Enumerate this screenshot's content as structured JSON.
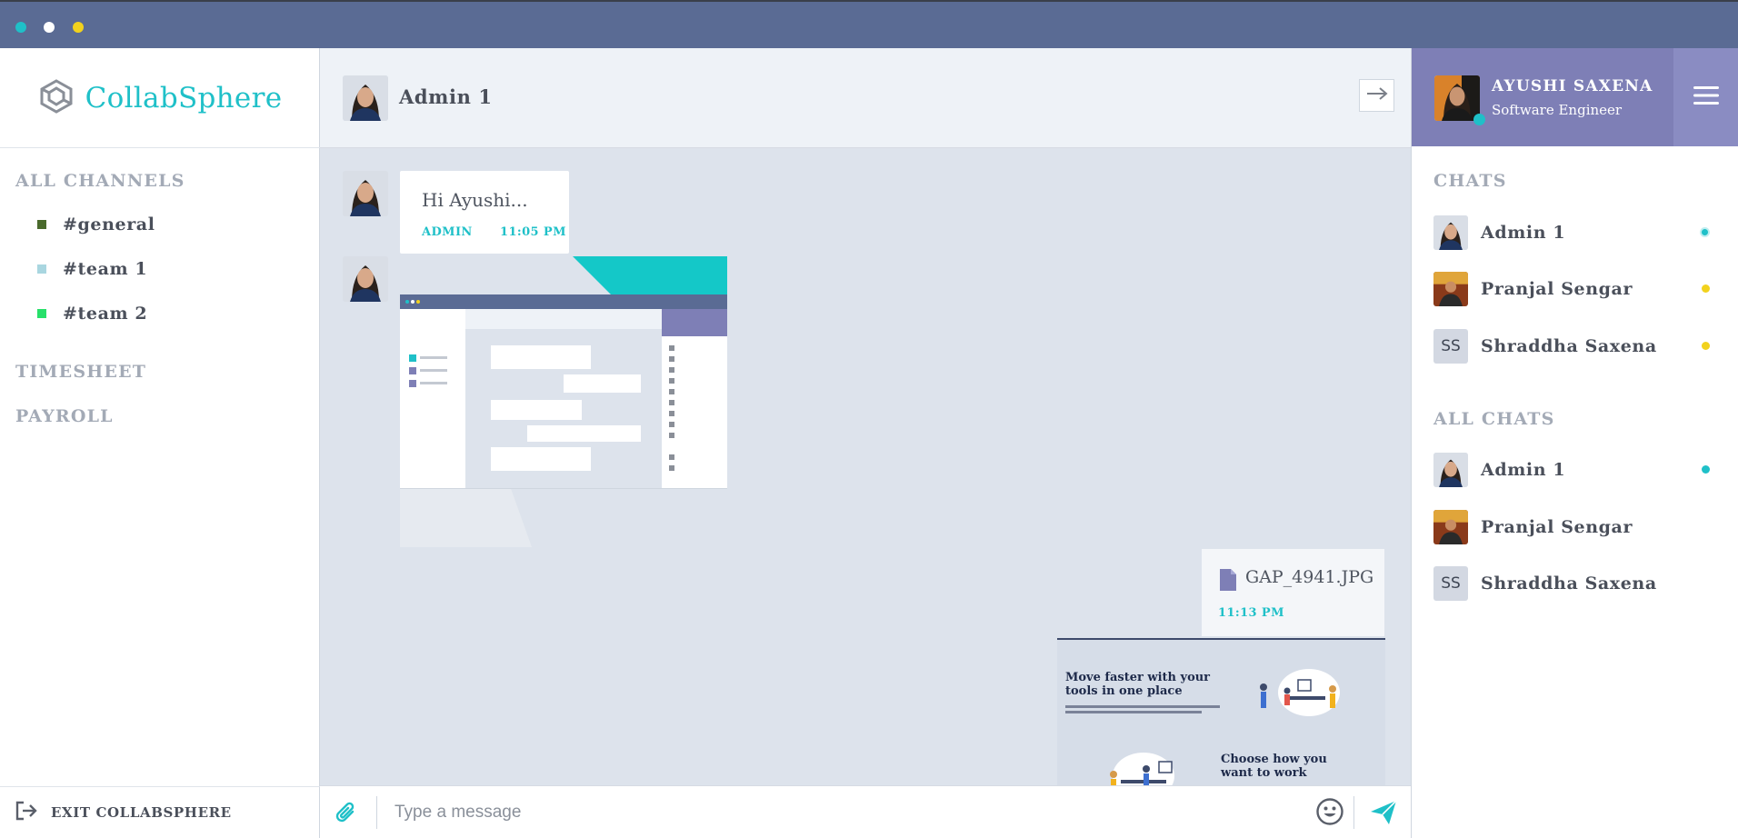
{
  "window": {
    "dots": [
      "#1fc0c8",
      "#ffffff",
      "#f2d21d"
    ]
  },
  "brand": {
    "name": "CollabSphere",
    "color": "#1fc0c8"
  },
  "sidebar": {
    "channels_label": "ALL CHANNELS",
    "channels": [
      {
        "name": "#general",
        "color": "#4a6a2c"
      },
      {
        "name": "#team 1",
        "color": "#a9d6e0"
      },
      {
        "name": "#team 2",
        "color": "#27e06a"
      }
    ],
    "timesheet_label": "TIMESHEET",
    "payroll_label": "PAYROLL",
    "exit_label": "EXIT COLLABSPHERE"
  },
  "chat": {
    "title": "Admin 1",
    "messages": [
      {
        "text": "Hi Ayushi...",
        "sender": "ADMIN",
        "time": "11:05 PM"
      }
    ],
    "file_message": {
      "filename": "GAP_4941.JPG",
      "time": "11:13 PM"
    },
    "promo": {
      "heading_1": "Move faster with your tools in one place",
      "heading_2": "Choose how you want to work"
    },
    "composer": {
      "placeholder": "Type a message"
    }
  },
  "profile": {
    "name": "AYUSHI SAXENA",
    "role": "Software Engineer"
  },
  "chats_label": "CHATS",
  "chats": [
    {
      "name": "Admin 1",
      "avatar": "photo-woman",
      "status_color": "#1fc0c8"
    },
    {
      "name": "Pranjal Sengar",
      "avatar": "photo-man",
      "status_color": "#f2d21d"
    },
    {
      "name": "Shraddha Saxena",
      "avatar": "SS",
      "status_color": "#f2d21d"
    }
  ],
  "all_chats_label": "ALL CHATS",
  "all_chats": [
    {
      "name": "Admin 1",
      "avatar": "photo-woman",
      "status_color": "#1fc0c8"
    },
    {
      "name": "Pranjal Sengar",
      "avatar": "photo-man",
      "status_color": null
    },
    {
      "name": "Shraddha Saxena",
      "avatar": "SS",
      "status_color": null
    }
  ]
}
